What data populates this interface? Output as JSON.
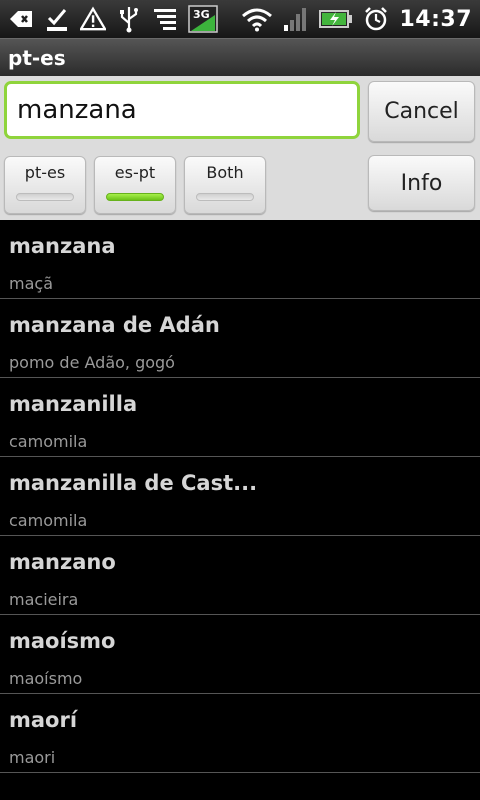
{
  "status_bar": {
    "time": "14:37",
    "network_label": "3G",
    "icons": [
      "back-arrow-icon",
      "download-done-icon",
      "warning-icon",
      "usb-icon",
      "menu-list-icon",
      "3g-icon",
      "wifi-icon",
      "signal-bars-icon",
      "battery-charging-icon",
      "alarm-clock-icon"
    ]
  },
  "title_bar": {
    "title": "pt-es"
  },
  "search": {
    "value": "manzana",
    "placeholder": ""
  },
  "buttons": {
    "cancel": "Cancel",
    "info": "Info"
  },
  "direction_toggles": [
    {
      "label": "pt-es",
      "active": false
    },
    {
      "label": "es-pt",
      "active": true
    },
    {
      "label": "Both",
      "active": false
    }
  ],
  "results": [
    {
      "term": "manzana",
      "translation": "maçã"
    },
    {
      "term": "manzana de Adán",
      "translation": "pomo de Adão, gogó"
    },
    {
      "term": "manzanilla",
      "translation": "camomila"
    },
    {
      "term": "manzanilla de Cast...",
      "translation": "camomila"
    },
    {
      "term": "manzano",
      "translation": "macieira"
    },
    {
      "term": "maoísmo",
      "translation": "maoísmo"
    },
    {
      "term": "maorí",
      "translation": "maori"
    }
  ],
  "colors": {
    "accent_green": "#8fd43c",
    "panel_bg": "#dcdcdc",
    "list_bg": "#000000"
  }
}
